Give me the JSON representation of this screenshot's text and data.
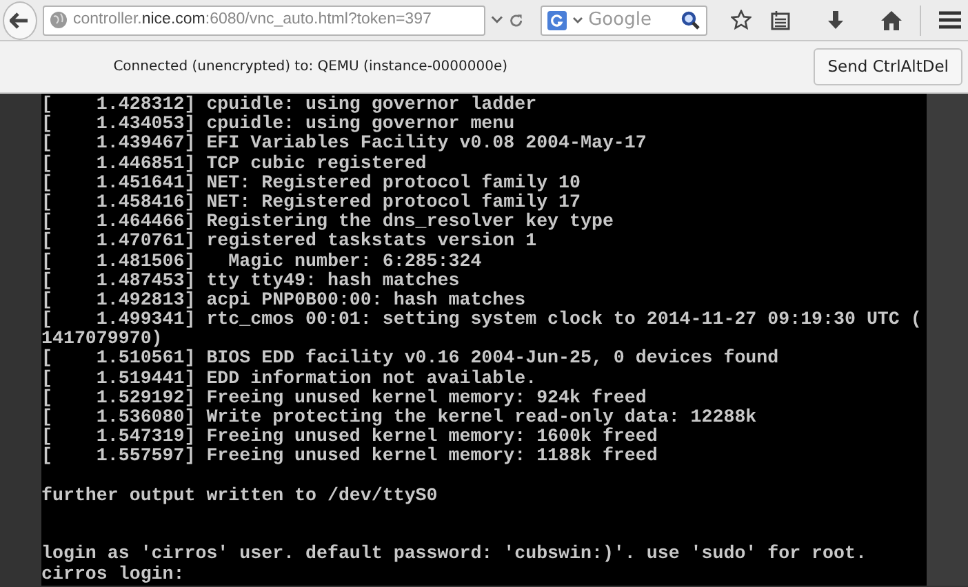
{
  "browser": {
    "url": {
      "prefix": "controller.",
      "domain": "nice.com",
      "suffix": ":6080/vnc_auto.html?token=397"
    },
    "search": {
      "placeholder": "Google"
    }
  },
  "vnc": {
    "status": "Connected (unencrypted) to: QEMU (instance-0000000e)",
    "button": "Send CtrlAltDel"
  },
  "console": {
    "lines": [
      {
        "text": "[    1.428312] cpuidle: using governor ladder"
      },
      {
        "text": "[    1.434053] cpuidle: using governor menu"
      },
      {
        "text": "[    1.439467] EFI Variables Facility v0.08 2004-May-17"
      },
      {
        "text": "[    1.446851] TCP cubic registered"
      },
      {
        "text": "[    1.451641] NET: Registered protocol family 10"
      },
      {
        "text": "[    1.458416] NET: Registered protocol family 17"
      },
      {
        "text": "[    1.464466] Registering the dns_resolver key type"
      },
      {
        "text": "[    1.470761] registered taskstats version 1"
      },
      {
        "text": "[    1.481506]   Magic number: 6:285:324"
      },
      {
        "text": "[    1.487453] tty tty49: hash matches"
      },
      {
        "text": "[    1.492813] acpi PNP0B00:00: hash matches"
      },
      {
        "text": "[    1.499341] rtc_cmos 00:01: setting system clock to 2014-11-27 09:19:30 UTC ("
      },
      {
        "text": "1417079970)"
      },
      {
        "text": "[    1.510561] BIOS EDD facility v0.16 2004-Jun-25, 0 devices found"
      },
      {
        "text": "[    1.519441] EDD information not available."
      },
      {
        "text": "[    1.529192] Freeing unused kernel memory: 924k freed"
      },
      {
        "text": "[    1.536080] Write protecting the kernel read-only data: 12288k"
      },
      {
        "text": "[    1.547319] Freeing unused kernel memory: 1600k freed"
      },
      {
        "text": "[    1.557597] Freeing unused kernel memory: 1188k freed"
      },
      {
        "kind": "blank"
      },
      {
        "text": "further output written to /dev/ttyS0"
      },
      {
        "kind": "blank"
      },
      {
        "kind": "blank"
      },
      {
        "text": "login as 'cirros' user. default password: 'cubswin:)'. use 'sudo' for root."
      },
      {
        "text": "cirros login:"
      }
    ]
  }
}
